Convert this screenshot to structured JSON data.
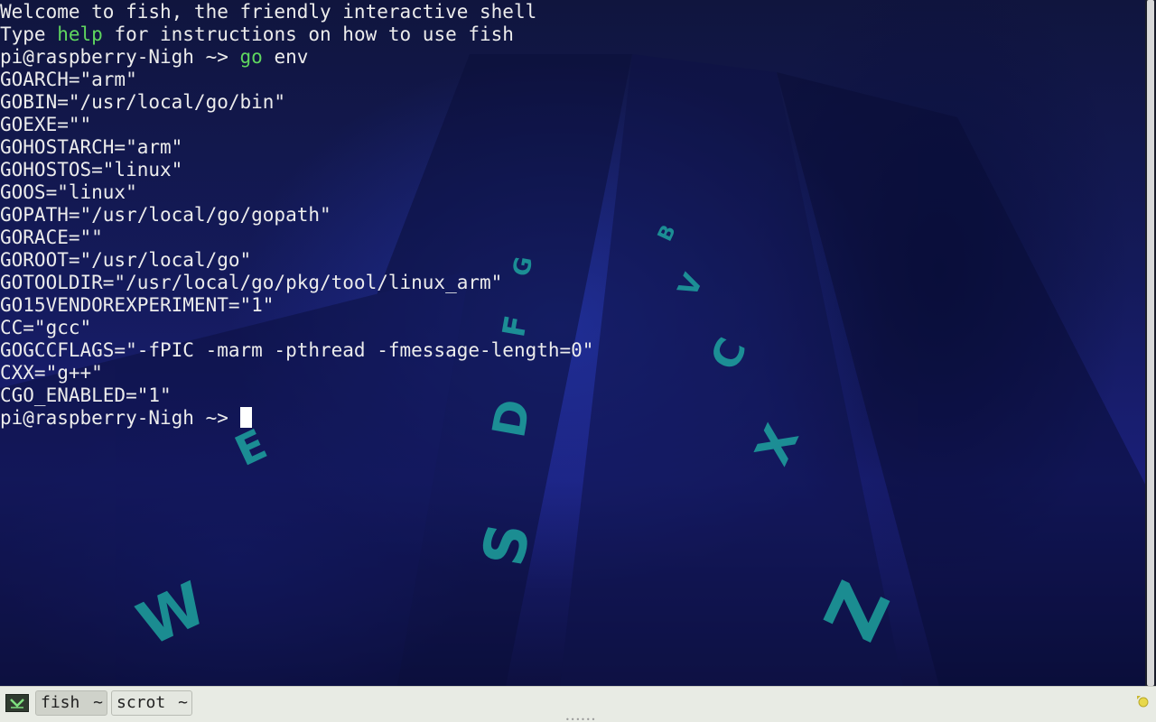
{
  "terminal": {
    "lines": [
      {
        "segments": [
          {
            "text": "Welcome to fish, the friendly interactive shell"
          }
        ]
      },
      {
        "segments": [
          {
            "text": "Type "
          },
          {
            "text": "help",
            "color": "green"
          },
          {
            "text": " for instructions on how to use fish"
          }
        ]
      },
      {
        "segments": [
          {
            "text": "pi@raspberry-Nigh ~> "
          },
          {
            "text": "go",
            "color": "green"
          },
          {
            "text": " env"
          }
        ]
      },
      {
        "segments": [
          {
            "text": "GOARCH=\"arm\""
          }
        ]
      },
      {
        "segments": [
          {
            "text": "GOBIN=\"/usr/local/go/bin\""
          }
        ]
      },
      {
        "segments": [
          {
            "text": "GOEXE=\"\""
          }
        ]
      },
      {
        "segments": [
          {
            "text": "GOHOSTARCH=\"arm\""
          }
        ]
      },
      {
        "segments": [
          {
            "text": "GOHOSTOS=\"linux\""
          }
        ]
      },
      {
        "segments": [
          {
            "text": "GOOS=\"linux\""
          }
        ]
      },
      {
        "segments": [
          {
            "text": "GOPATH=\"/usr/local/go/gopath\""
          }
        ]
      },
      {
        "segments": [
          {
            "text": "GORACE=\"\""
          }
        ]
      },
      {
        "segments": [
          {
            "text": "GOROOT=\"/usr/local/go\""
          }
        ]
      },
      {
        "segments": [
          {
            "text": "GOTOOLDIR=\"/usr/local/go/pkg/tool/linux_arm\""
          }
        ]
      },
      {
        "segments": [
          {
            "text": "GO15VENDOREXPERIMENT=\"1\""
          }
        ]
      },
      {
        "segments": [
          {
            "text": "CC=\"gcc\""
          }
        ]
      },
      {
        "segments": [
          {
            "text": "GOGCCFLAGS=\"-fPIC -marm -pthread -fmessage-length=0\""
          }
        ]
      },
      {
        "segments": [
          {
            "text": "CXX=\"g++\""
          }
        ]
      },
      {
        "segments": [
          {
            "text": "CGO_ENABLED=\"1\""
          }
        ]
      }
    ],
    "prompt": "pi@raspberry-Nigh ~> ",
    "colors": {
      "text": "#ececec",
      "green": "#5fd75f",
      "cursor": "#ffffff"
    }
  },
  "wallpaper": {
    "keycap_letters": [
      "E",
      "D",
      "F",
      "G",
      "S",
      "W",
      "C",
      "X",
      "Z",
      "V",
      "B"
    ]
  },
  "tabbar": {
    "tabs": [
      {
        "label": "fish",
        "caret": "~",
        "active": true
      },
      {
        "label": "scrot",
        "caret": "~",
        "active": false
      }
    ],
    "app_icon": "terminal-app-icon",
    "notify_icon": "notification-icon"
  }
}
